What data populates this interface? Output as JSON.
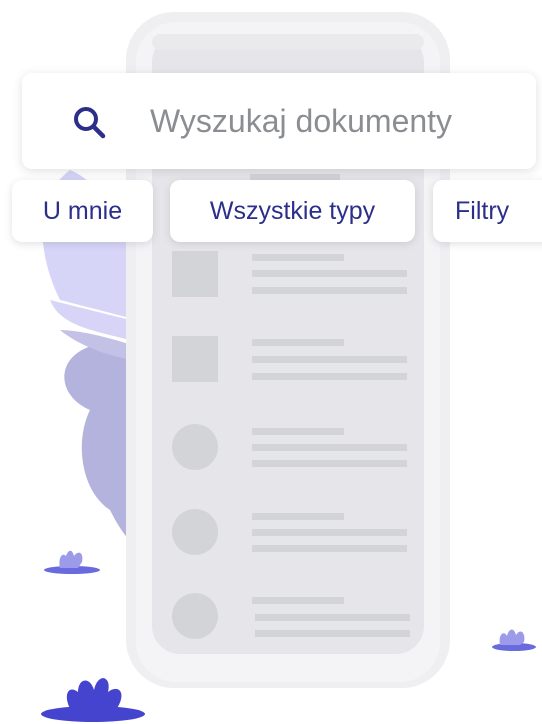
{
  "search": {
    "placeholder": "Wyszukaj dokumenty",
    "icon": "search-icon"
  },
  "chips": {
    "mine": "U mnie",
    "all_types": "Wszystkie typy",
    "filters": "Filtry"
  },
  "colors": {
    "accent": "#2b2f8a",
    "placeholder_text": "#8a8d91",
    "phone_body": "#efeff2",
    "phone_screen": "#e6e6ea",
    "list_placeholder": "#d3d4d8",
    "blob_light": "#d6d5f7",
    "blob_dark": "#b3b3dd",
    "plant": "#4444cf"
  },
  "illustration": {
    "name": "empty-document-list-phone-illustration"
  }
}
